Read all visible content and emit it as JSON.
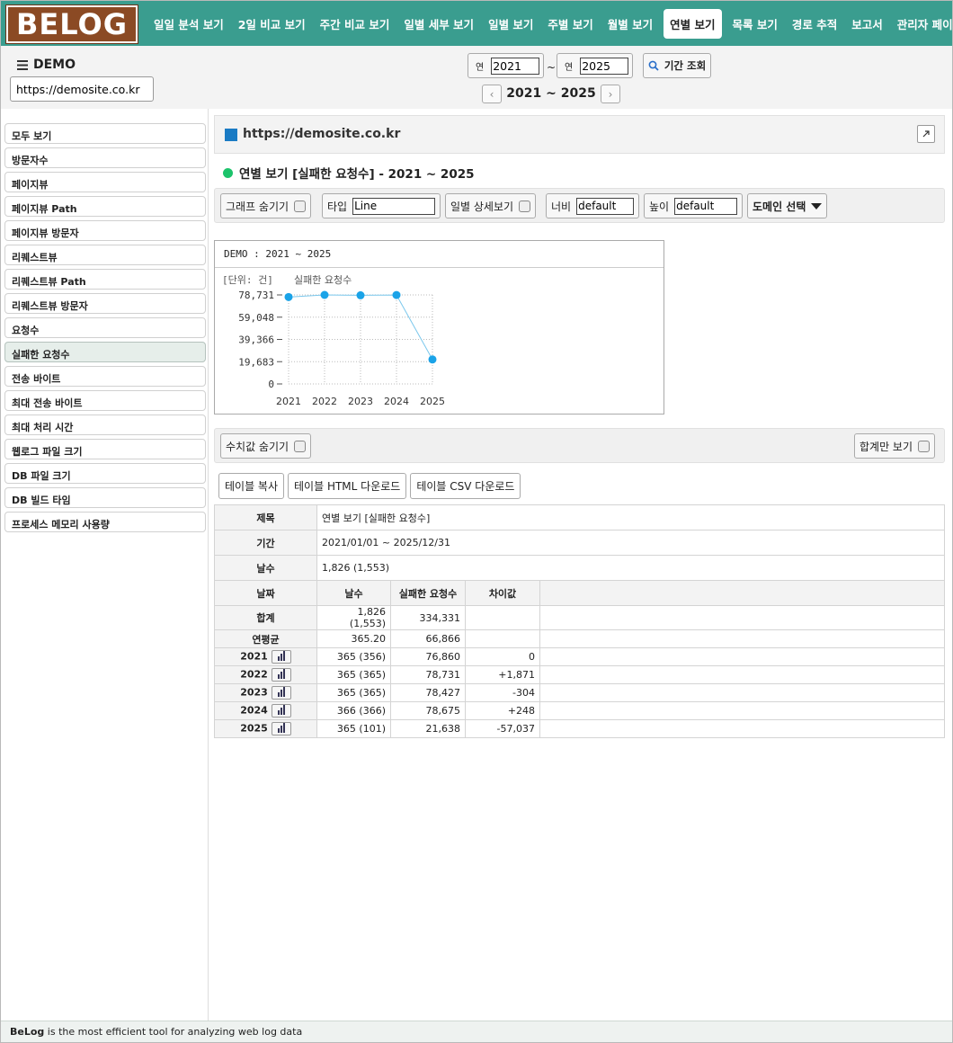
{
  "app": {
    "logo": "BELOG"
  },
  "nav": {
    "items": [
      "일일 분석 보기",
      "2일 비교 보기",
      "주간 비교 보기",
      "일별 세부 보기",
      "일별 보기",
      "주별 보기",
      "월별 보기",
      "연별 보기",
      "목록 보기",
      "경로 추적",
      "보고서",
      "관리자 페이지"
    ],
    "active_index": 7
  },
  "header": {
    "site_name": "DEMO",
    "site_url": "https://demosite.co.kr",
    "year_prefix": "연",
    "from_year": "2021",
    "to_year": "2025",
    "tilde": "~",
    "query_label": "기간 조회",
    "range_label": "2021 ~ 2025",
    "prev_label": "‹",
    "next_label": "›"
  },
  "sidebar": {
    "items": [
      "모두 보기",
      "방문자수",
      "페이지뷰",
      "페이지뷰 Path",
      "페이지뷰 방문자",
      "리퀘스트뷰",
      "리퀘스트뷰 Path",
      "리퀘스트뷰 방문자",
      "요청수",
      "실패한 요청수",
      "전송 바이트",
      "최대 전송 바이트",
      "최대 처리 시간",
      "웹로그 파일 크기",
      "DB 파일 크기",
      "DB 빌드 타임",
      "프로세스 메모리 사용량"
    ],
    "active_index": 9
  },
  "main": {
    "panel_title": "https://demosite.co.kr",
    "section_title": "연별 보기 [실패한 요청수] - 2021 ~ 2025",
    "toolbar": {
      "hide_graph": "그래프 숨기기",
      "type_label": "타입",
      "type_value": "Line",
      "daily_detail": "일별 상세보기",
      "width_label": "너비",
      "width_value": "default",
      "height_label": "높이",
      "height_value": "default",
      "domain_select": "도메인 선택"
    },
    "toolbar2": {
      "hide_values": "수치값 숨기기",
      "totals_only": "합계만 보기"
    },
    "buttons": {
      "copy": "테이블 복사",
      "html": "테이블 HTML 다운로드",
      "csv": "테이블 CSV 다운로드"
    }
  },
  "chart_data": {
    "type": "line",
    "title": "DEMO : 2021 ~ 2025",
    "unit_label": "[단위: 건]",
    "series_label": "실패한 요청수",
    "x": [
      "2021",
      "2022",
      "2023",
      "2024",
      "2025"
    ],
    "series": [
      {
        "name": "실패한 요청수",
        "values": [
          76860,
          78731,
          78427,
          78675,
          21638
        ]
      }
    ],
    "y_ticks": [
      "78,731",
      "59,048",
      "39,366",
      "19,683",
      "0"
    ],
    "ylim": [
      0,
      78731
    ],
    "grid": true,
    "color": "#1aa3e8"
  },
  "table": {
    "info": [
      {
        "label": "제목",
        "value": "연별 보기 [실패한 요청수]"
      },
      {
        "label": "기간",
        "value": "2021/01/01 ~ 2025/12/31"
      },
      {
        "label": "날수",
        "value": "1,826 (1,553)"
      }
    ],
    "columns": [
      "날짜",
      "날수",
      "실패한 요청수",
      "차이값"
    ],
    "summary": [
      {
        "label": "합계",
        "days": "1,826 (1,553)",
        "value": "334,331",
        "diff": ""
      },
      {
        "label": "연평균",
        "days": "365.20",
        "value": "66,866",
        "diff": ""
      }
    ],
    "rows": [
      {
        "label": "2021",
        "days": "365 (356)",
        "value": "76,860",
        "diff": "0"
      },
      {
        "label": "2022",
        "days": "365 (365)",
        "value": "78,731",
        "diff": "+1,871"
      },
      {
        "label": "2023",
        "days": "365 (365)",
        "value": "78,427",
        "diff": "-304"
      },
      {
        "label": "2024",
        "days": "366 (366)",
        "value": "78,675",
        "diff": "+248"
      },
      {
        "label": "2025",
        "days": "365 (101)",
        "value": "21,638",
        "diff": "-57,037"
      }
    ]
  },
  "footer": {
    "brand": "BeLog",
    "text": " is the most efficient tool for analyzing web log data"
  }
}
